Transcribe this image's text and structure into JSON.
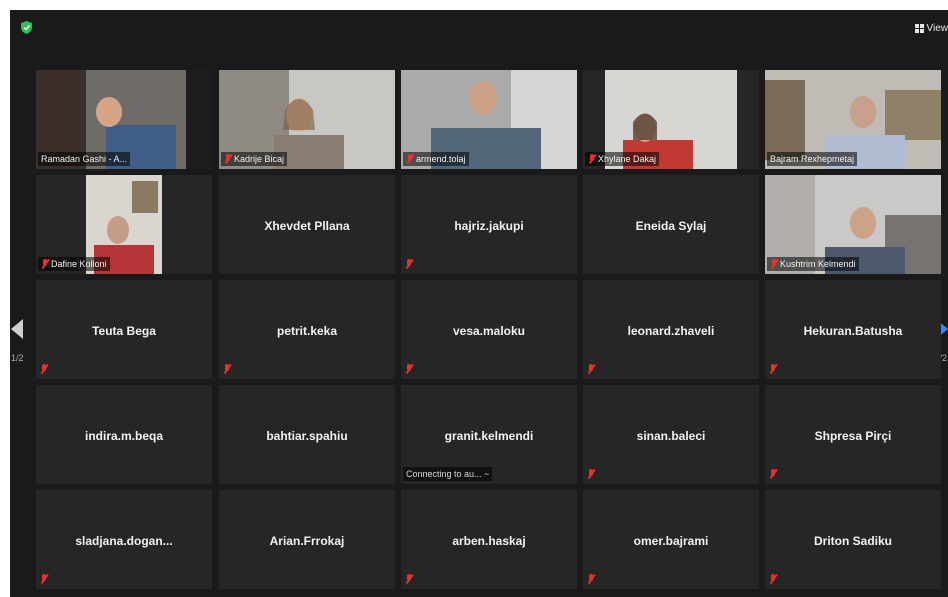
{
  "toolbar": {
    "view_label": "View"
  },
  "pager": {
    "left_page": "1/2",
    "right_page": "1/2"
  },
  "colors": {
    "active_outline": "#cfe64a",
    "muted_mic": "#e8312f",
    "next_arrow": "#2d8cff"
  },
  "participants": [
    {
      "name": "Ramadan Gashi - A...",
      "video": true,
      "muted": false,
      "active": true
    },
    {
      "name": "Kadrije Bicaj",
      "video": true,
      "muted": true
    },
    {
      "name": "armend.tolaj",
      "video": true,
      "muted": true
    },
    {
      "name": "Xhylane Dakaj",
      "video": true,
      "muted": true
    },
    {
      "name": "Bajram Rexhepmetaj",
      "video": true,
      "muted": false
    },
    {
      "name": "Dafine Kolloni",
      "video": true,
      "muted": true
    },
    {
      "name": "Xhevdet Pllana",
      "video": false,
      "muted": false
    },
    {
      "name": "hajriz.jakupi",
      "video": false,
      "muted": true
    },
    {
      "name": "Eneida Sylaj",
      "video": false,
      "muted": false
    },
    {
      "name": "Kushtrim Kelmendi",
      "video": true,
      "muted": true
    },
    {
      "name": "Teuta Bega",
      "video": false,
      "muted": true
    },
    {
      "name": "petrit.keka",
      "video": false,
      "muted": true
    },
    {
      "name": "vesa.maloku",
      "video": false,
      "muted": true
    },
    {
      "name": "leonard.zhaveli",
      "video": false,
      "muted": true
    },
    {
      "name": "Hekuran.Batusha",
      "video": false,
      "muted": true
    },
    {
      "name": "indira.m.beqa",
      "video": false,
      "muted": false
    },
    {
      "name": "bahtiar.spahiu",
      "video": false,
      "muted": false
    },
    {
      "name": "granit.kelmendi",
      "video": false,
      "muted": false,
      "status": "Connecting to au... ~"
    },
    {
      "name": "sinan.baleci",
      "video": false,
      "muted": true
    },
    {
      "name": "Shpresa Pirçi",
      "video": false,
      "muted": true
    },
    {
      "name": "sladjana.dogan...",
      "video": false,
      "muted": true
    },
    {
      "name": "Arian.Frrokaj",
      "video": false,
      "muted": false
    },
    {
      "name": "arben.haskaj",
      "video": false,
      "muted": true
    },
    {
      "name": "omer.bajrami",
      "video": false,
      "muted": true
    },
    {
      "name": "Driton Sadiku",
      "video": false,
      "muted": true
    }
  ]
}
